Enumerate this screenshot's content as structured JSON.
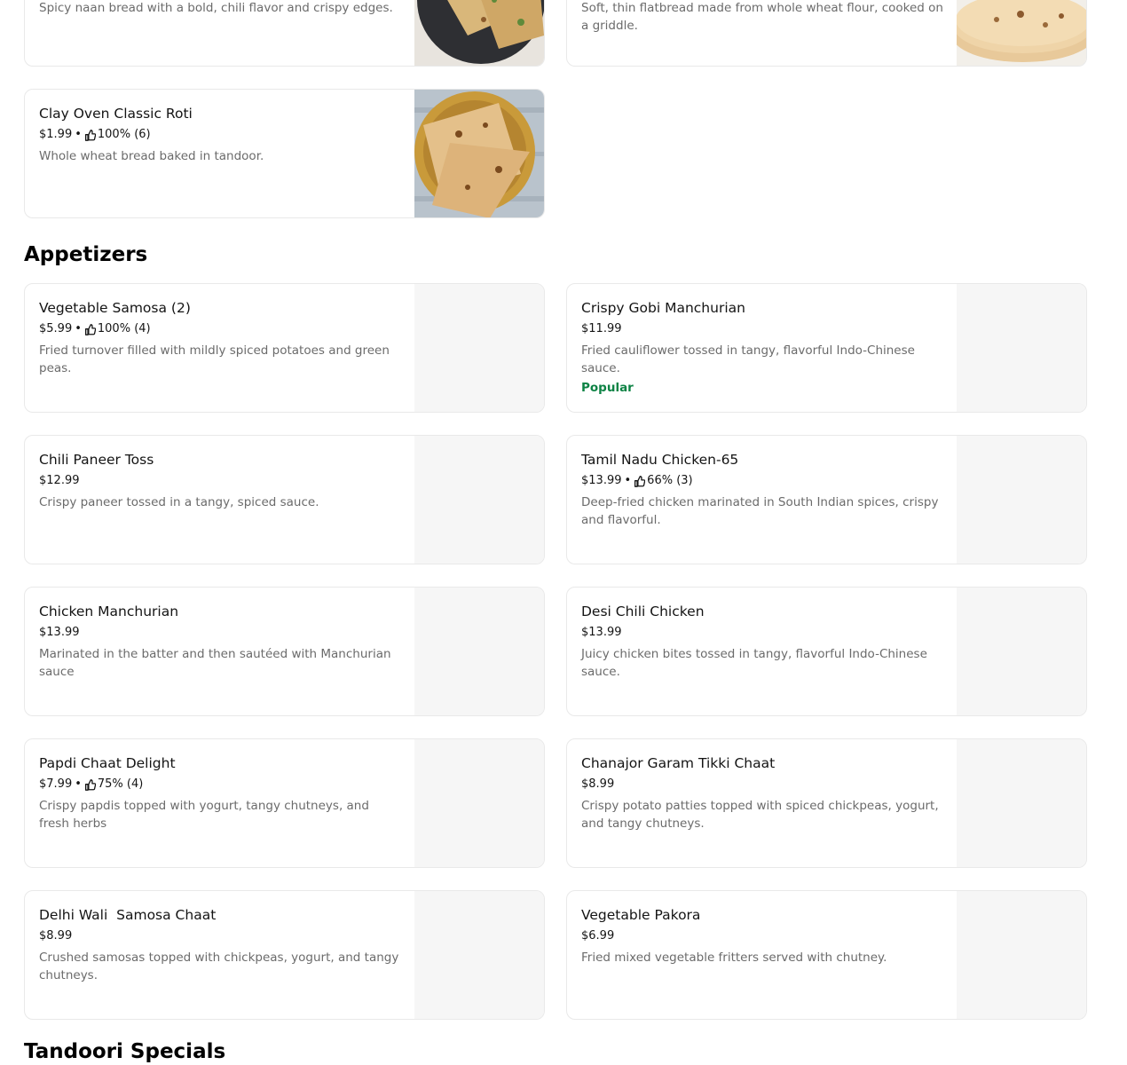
{
  "top_cards": [
    {
      "desc": "Spicy naan bread with a bold, chili flavor and crispy edges.",
      "image": "chili-naan-photo"
    },
    {
      "desc": "Soft, thin flatbread made from whole wheat flour, cooked on a griddle.",
      "image": "chapati-photo"
    }
  ],
  "roti_card": {
    "name": "Clay Oven Classic Roti",
    "price": "$1.99",
    "rating": "100% (6)",
    "desc": "Whole wheat bread baked in tandoor.",
    "image": "tandoori-roti-photo"
  },
  "appetizers": {
    "title": "Appetizers",
    "items": [
      {
        "name": "Vegetable Samosa (2)",
        "price": "$5.99",
        "rating": "100% (4)",
        "desc": "Fried turnover filled with mildly spiced potatoes and green peas.",
        "badge": ""
      },
      {
        "name": "Crispy Gobi Manchurian",
        "price": "$11.99",
        "rating": "",
        "desc": "Fried cauliflower tossed in tangy, flavorful Indo-Chinese sauce.",
        "badge": "Popular"
      },
      {
        "name": "Chili Paneer Toss",
        "price": "$12.99",
        "rating": "",
        "desc": "Crispy paneer tossed in a tangy, spiced sauce.",
        "badge": ""
      },
      {
        "name": "Tamil Nadu Chicken-65",
        "price": "$13.99",
        "rating": "66% (3)",
        "desc": "Deep-fried chicken marinated in South Indian spices, crispy and flavorful.",
        "badge": ""
      },
      {
        "name": "Chicken Manchurian",
        "price": "$13.99",
        "rating": "",
        "desc": "Marinated in the batter and then sautéed with Manchurian sauce",
        "badge": ""
      },
      {
        "name": "Desi Chili Chicken",
        "price": "$13.99",
        "rating": "",
        "desc": "Juicy chicken bites tossed in tangy, flavorful Indo-Chinese sauce.",
        "badge": ""
      },
      {
        "name": "Papdi Chaat Delight",
        "price": "$7.99",
        "rating": "75% (4)",
        "desc": "Crispy papdis topped with yogurt, tangy chutneys, and fresh herbs",
        "badge": ""
      },
      {
        "name": "Chanajor Garam Tikki Chaat",
        "price": "$8.99",
        "rating": "",
        "desc": "Crispy potato patties topped with spiced chickpeas, yogurt, and tangy chutneys.",
        "badge": ""
      },
      {
        "name": "Delhi Wali  Samosa Chaat",
        "price": "$8.99",
        "rating": "",
        "desc": "Crushed samosas topped with chickpeas, yogurt, and tangy chutneys.",
        "badge": ""
      },
      {
        "name": "Vegetable Pakora",
        "price": "$6.99",
        "rating": "",
        "desc": "Fried mixed vegetable fritters served with chutney.",
        "badge": ""
      }
    ]
  },
  "next_section": {
    "title": "Tandoori Specials"
  },
  "icons": {
    "rating": "thumbs-up-icon"
  },
  "colors": {
    "popular_badge": "#0e8345",
    "description": "#6b6b6b",
    "card_border": "#e9e9e9",
    "image_placeholder": "#f6f6f6"
  }
}
